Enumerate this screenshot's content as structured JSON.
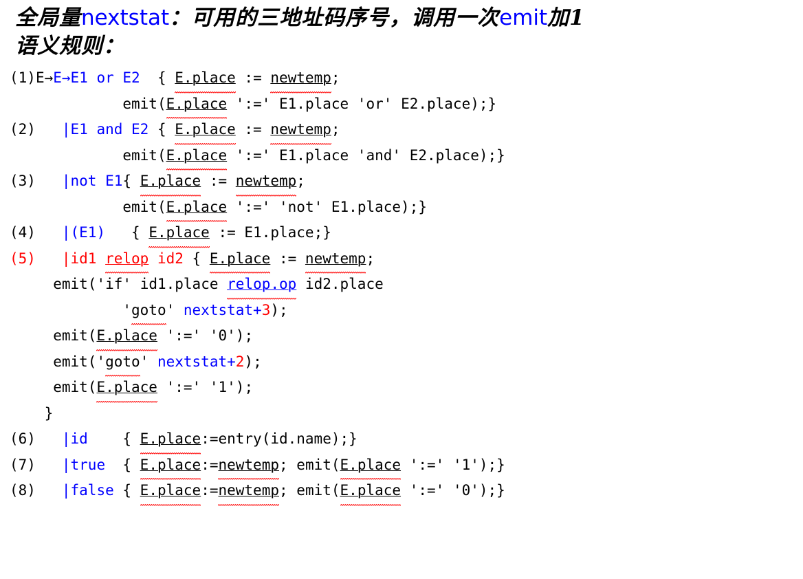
{
  "document": {
    "title_lines": [
      {
        "id": "global-var-note",
        "segments": [
          {
            "text": "全局量",
            "style": "cjk",
            "color": "#000000"
          },
          {
            "text": "nextstat",
            "style": "latin",
            "color": "#0000ff"
          },
          {
            "text": "：可用的三地址码序号，调用一次",
            "style": "cjk",
            "color": "#000000"
          },
          {
            "text": "emit",
            "style": "latin",
            "color": "#0000ff"
          },
          {
            "text": "加1",
            "style": "cjk",
            "color": "#000000"
          }
        ],
        "plain": "全局量nextstat：可用的三地址码序号，调用一次emit加1"
      },
      {
        "id": "semantic-rules-heading",
        "segments": [
          {
            "text": "语义规则：",
            "style": "cjk",
            "color": "#000000"
          }
        ],
        "plain": "语义规则："
      }
    ],
    "rules": [
      {
        "number": "(1)",
        "number_color": "#000000",
        "production": "E→E1 or E2",
        "lines": [
          "(1)E→E1 or E2  { E.place := newtemp;",
          "             emit(E.place ':=' E1.place 'or' E2.place);}"
        ]
      },
      {
        "number": "(2)",
        "number_color": "#000000",
        "production": "|E1 and E2",
        "lines": [
          "(2)   |E1 and E2 { E.place := newtemp;",
          "             emit(E.place ':=' E1.place 'and' E2.place);}"
        ]
      },
      {
        "number": "(3)",
        "number_color": "#000000",
        "production": "|not E1",
        "lines": [
          "(3)   |not E1{ E.place := newtemp;",
          "             emit(E.place ':=' 'not' E1.place);}"
        ]
      },
      {
        "number": "(4)",
        "number_color": "#000000",
        "production": "|(E1)",
        "lines": [
          "(4)   |(E1)   { E.place := E1.place;}"
        ]
      },
      {
        "number": "(5)",
        "number_color": "#ff0000",
        "production": "|id1 relop id2",
        "lines": [
          "(5)   |id1 relop id2 { E.place := newtemp;",
          "     emit('if' id1.place relop.op id2.place",
          "             'goto' nextstat+3);",
          "     emit(E.place ':=' '0');",
          "     emit('goto' nextstat+2);",
          "     emit(E.place ':=' '1');",
          "    }"
        ]
      },
      {
        "number": "(6)",
        "number_color": "#000000",
        "production": "|id",
        "lines": [
          "(6)   |id    { E.place:=entry(id.name);}"
        ]
      },
      {
        "number": "(7)",
        "number_color": "#000000",
        "production": "|true",
        "lines": [
          "(7)   |true  { E.place:=newtemp; emit(E.place ':=' '1');}"
        ]
      },
      {
        "number": "(8)",
        "number_color": "#000000",
        "production": "|false",
        "lines": [
          "(8)   |false { E.place:=newtemp; emit(E.place ':=' '0');}"
        ]
      }
    ],
    "tokens": {
      "rule_1_num": "(1)",
      "rule_1_lhs": "E",
      "arrow": "→",
      "rule_1_rhs": "E1 or E2",
      "rule_2_num": "(2)",
      "rule_2_rhs": "|E1 and E2",
      "rule_3_num": "(3)",
      "rule_3_rhs": "|not E1",
      "rule_4_num": "(4)",
      "rule_4_rhs": "|(E1)",
      "rule_5_num": "(5)",
      "rule_5_rhs": "|id1 ",
      "rule_5_relop": "relop",
      "rule_5_rhs2": " id2",
      "rule_6_num": "(6)",
      "rule_6_rhs": "|id",
      "rule_7_num": "(7)",
      "rule_7_rhs": "|true",
      "rule_8_num": "(8)",
      "rule_8_rhs": "|false",
      "eplace": "E.place",
      "newtemp": "newtemp",
      "relop_op": "relop.op",
      "nextstat": "nextstat+",
      "goto": "goto",
      "three": "3",
      "two": "2",
      "one": "1",
      "zero": "0",
      "emit": "emit",
      "assign_q": "':='",
      "or_q": "'or'",
      "and_q": "'and'",
      "not_q": "'not'",
      "if_q": "'if'",
      "one_q": "'1'",
      "zero_q": "'0'",
      "e1place": "E1.place",
      "e2place": "E2.place",
      "id1place": "id1.place",
      "id2place": "id2.place",
      "close_brace": "}",
      "open_brace": "{"
    },
    "colors": {
      "black": "#000000",
      "blue": "#0000ff",
      "red": "#ff0000",
      "background": "#ffffff",
      "squiggle": "#ff0000"
    }
  }
}
